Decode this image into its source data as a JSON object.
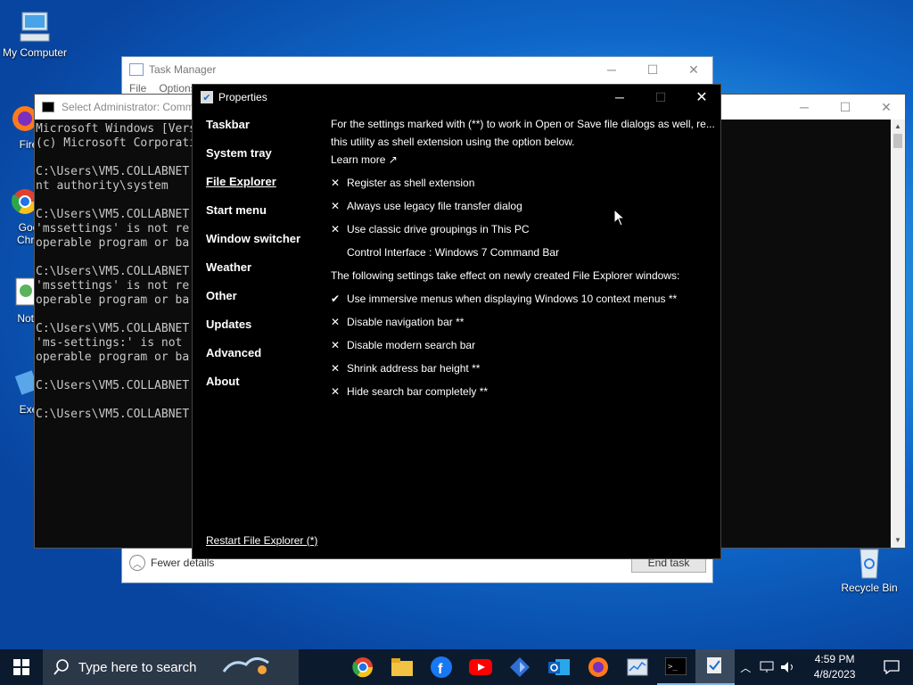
{
  "desktop": {
    "icons": [
      {
        "label": "My Computer",
        "icon": "computer-icon"
      },
      {
        "label": "Fire",
        "icon": "firefox-icon"
      },
      {
        "label": "Goo Chro",
        "icon": "chrome-icon"
      },
      {
        "label": "Note",
        "icon": "notepad-icon"
      },
      {
        "label": "Exe",
        "icon": "exe-icon"
      },
      {
        "label": "Recycle Bin",
        "icon": "recycle-bin-icon"
      }
    ]
  },
  "task_manager": {
    "title": "Task Manager",
    "menu": [
      "File",
      "Options"
    ],
    "fewer_details": "Fewer details",
    "end_task": "End task"
  },
  "cmd": {
    "title": "Select Administrator: Comm",
    "lines": [
      "Microsoft Windows [Vers",
      "(c) Microsoft Corporati",
      "",
      "C:\\Users\\VM5.COLLABNET",
      "nt authority\\system",
      "",
      "C:\\Users\\VM5.COLLABNET",
      "'mssettings' is not re",
      "operable program or ba",
      "",
      "C:\\Users\\VM5.COLLABNET",
      "'mssettings' is not re",
      "operable program or ba",
      "",
      "C:\\Users\\VM5.COLLABNET",
      "'ms-settings:' is not ",
      "operable program or ba",
      "",
      "C:\\Users\\VM5.COLLABNET",
      "",
      "C:\\Users\\VM5.COLLABNET"
    ]
  },
  "properties": {
    "title": "Properties",
    "nav": [
      "Taskbar",
      "System tray",
      "File Explorer",
      "Start menu",
      "Window switcher",
      "Weather",
      "Other",
      "Updates",
      "Advanced",
      "About"
    ],
    "selected_nav": "File Explorer",
    "intro_line1": "For the settings marked with (**) to work in Open or Save file dialogs as well, re...",
    "intro_line2": "this utility as shell extension using the option below.",
    "learn_more": "Learn more ↗",
    "options_top": [
      {
        "mark": "✕",
        "label": "Register as shell extension"
      },
      {
        "mark": "✕",
        "label": "Always use legacy file transfer dialog"
      },
      {
        "mark": "✕",
        "label": "Use classic drive groupings in This PC"
      },
      {
        "mark": "",
        "label": "Control Interface : Windows 7 Command Bar"
      }
    ],
    "section_note": "The following settings take effect on newly created File Explorer windows:",
    "options_bottom": [
      {
        "mark": "✔",
        "label": "Use immersive menus when displaying Windows 10 context menus **"
      },
      {
        "mark": "✕",
        "label": "Disable navigation bar **"
      },
      {
        "mark": "✕",
        "label": "Disable modern search bar"
      },
      {
        "mark": "✕",
        "label": "Shrink address bar height **"
      },
      {
        "mark": "✕",
        "label": "Hide search bar completely **"
      }
    ],
    "restart_link": "Restart File Explorer (*)"
  },
  "taskbar": {
    "search_placeholder": "Type here to search",
    "apps": [
      "chrome-icon",
      "file-explorer-icon",
      "facebook-icon",
      "youtube-icon",
      "app-icon",
      "outlook-icon",
      "firefox-icon",
      "task-manager-icon",
      "cmd-icon",
      "properties-icon"
    ],
    "time": "4:59 PM",
    "date": "4/8/2023"
  }
}
